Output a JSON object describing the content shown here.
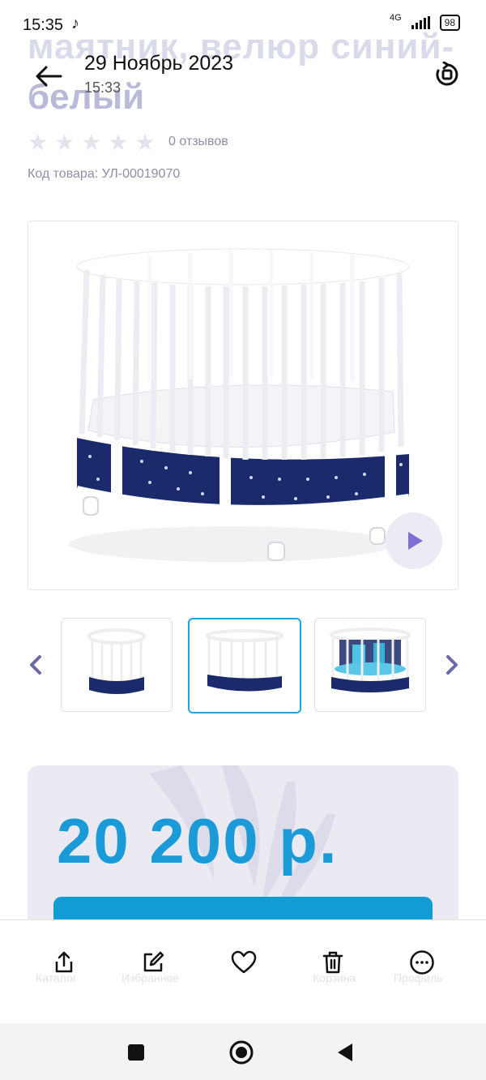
{
  "status_bar": {
    "time": "15:35",
    "network": "4G",
    "battery": "98"
  },
  "background_page": {
    "title_line1": "маятник, велюр синий-",
    "title_line2": "белый",
    "reviews": "0 отзывов",
    "sku": "Код товара: УЛ-00019070",
    "price": "20 200 р.",
    "nav_labels": [
      "Каталог",
      "Избранное",
      "Корзина",
      "Профиль"
    ]
  },
  "viewer": {
    "date": "29 Ноябрь 2023",
    "time": "15:33"
  },
  "icons": {
    "back": "arrow-left-icon",
    "rotate": "rotate-icon",
    "play": "play-icon",
    "share": "share-icon",
    "edit": "edit-icon",
    "favorite": "heart-icon",
    "delete": "trash-icon",
    "more": "more-icon"
  },
  "colors": {
    "accent": "#1a9bd7",
    "cot_fabric": "#1b2a6b",
    "card_bg": "#ebeaf3",
    "play_arrow": "#7c6fd6"
  }
}
